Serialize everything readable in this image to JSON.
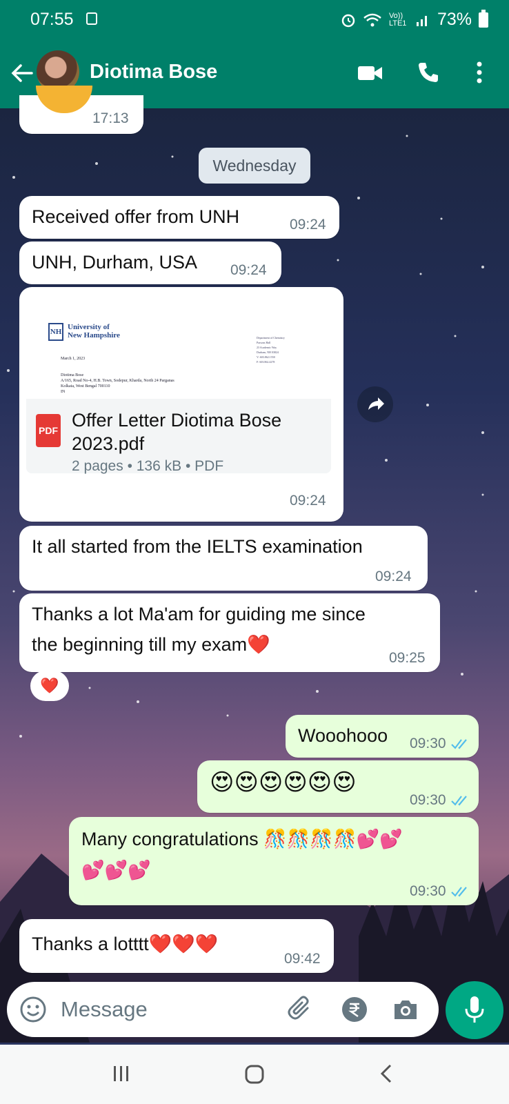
{
  "status_bar": {
    "time": "07:55",
    "network": "Vo)) LTE1",
    "battery": "73%"
  },
  "header": {
    "contact_name": "Diotima Bose"
  },
  "chat": {
    "prev_time": "17:13",
    "date_chip": "Wednesday",
    "messages": [
      {
        "text": "Received offer from UNH",
        "time": "09:24"
      },
      {
        "text": "UNH, Durham, USA",
        "time": "09:24"
      },
      {
        "text": "It all started from the IELTS examination",
        "time": "09:24"
      },
      {
        "text_line1": "Thanks a lot Ma'am for guiding me since",
        "text_line2": "the beginning till my exam❤️",
        "time": "09:25",
        "reaction": "❤️"
      },
      {
        "text": "Wooohooo",
        "time": "09:30"
      },
      {
        "text": "😍😍😍😍😍😍",
        "time": "09:30"
      },
      {
        "text_line1": "Many congratulations 🎊🎊🎊🎊💕💕",
        "text_line2": "💕💕💕",
        "time": "09:30"
      },
      {
        "text": "Thanks a lotttt❤️❤️❤️",
        "time": "09:42"
      }
    ],
    "document": {
      "preview": {
        "university_line1": "University of",
        "university_line2": "New Hampshire",
        "date": "March 1, 2023",
        "addr1": "Diotima Bose",
        "addr2": "A/165, Road No-4, H.B. Town, Sodepur, Kharda, North 24 Parganas",
        "addr3": "Kolkata, West Bengal 700110",
        "addr4": "IN",
        "dept1": "Department of Chemistry",
        "dept2": "Parsons Hall",
        "dept3": "23 Academic Way",
        "dept4": "Durham, NH 03824",
        "phone": "V: 603.862.1550",
        "fax": "F: 603.862.4278"
      },
      "file_name_line1": "Offer Letter Diotima Bose",
      "file_name_line2": "2023.pdf",
      "meta": "2 pages • 136 kB • PDF",
      "icon_label": "PDF",
      "time": "09:24"
    }
  },
  "input": {
    "placeholder": "Message"
  },
  "colors": {
    "header": "#008069",
    "outgoing_bubble": "#e7ffdb",
    "read_tick": "#53bdeb",
    "mic": "#00a884"
  }
}
